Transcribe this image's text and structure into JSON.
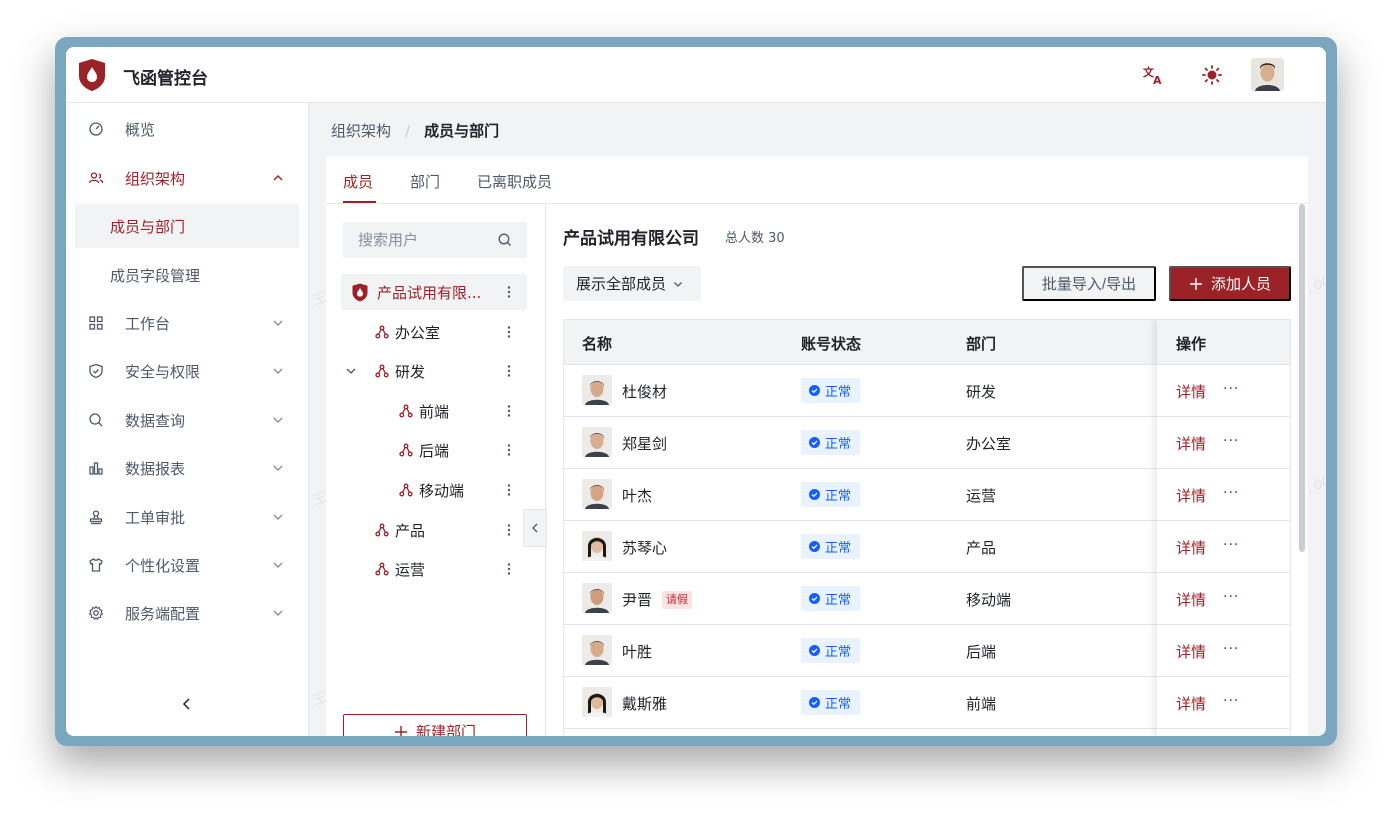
{
  "app": {
    "title": "飞函管控台"
  },
  "sidebar": {
    "items": [
      {
        "label": "概览"
      },
      {
        "label": "组织架构",
        "sub": [
          {
            "label": "成员与部门"
          },
          {
            "label": "成员字段管理"
          }
        ]
      },
      {
        "label": "工作台"
      },
      {
        "label": "安全与权限"
      },
      {
        "label": "数据查询"
      },
      {
        "label": "数据报表"
      },
      {
        "label": "工单审批"
      },
      {
        "label": "个性化设置"
      },
      {
        "label": "服务端配置"
      }
    ]
  },
  "breadcrumb": {
    "parent": "组织架构",
    "current": "成员与部门"
  },
  "tabs": [
    {
      "label": "成员"
    },
    {
      "label": "部门"
    },
    {
      "label": "已离职成员"
    }
  ],
  "tree": {
    "search_placeholder": "搜索用户",
    "nodes": [
      {
        "label": "产品试用有限..."
      },
      {
        "label": "办公室"
      },
      {
        "label": "研发"
      },
      {
        "label": "前端"
      },
      {
        "label": "后端"
      },
      {
        "label": "移动端"
      },
      {
        "label": "产品"
      },
      {
        "label": "运营"
      }
    ],
    "new_dept_label": "新建部门"
  },
  "panel": {
    "company": "产品试用有限公司",
    "total": "总人数 30",
    "filter_label": "展示全部成员",
    "import_label": "批量导入/导出",
    "add_label": "添加人员"
  },
  "table": {
    "headers": {
      "name": "名称",
      "status": "账号状态",
      "dept": "部门",
      "ops": "操作"
    },
    "rows": [
      {
        "name": "杜俊材",
        "status": "正常",
        "dept": "研发",
        "detail": "详情",
        "more": "···"
      },
      {
        "name": "郑星剑",
        "status": "正常",
        "dept": "办公室",
        "detail": "详情",
        "more": "···"
      },
      {
        "name": "叶杰",
        "status": "正常",
        "dept": "运营",
        "detail": "详情",
        "more": "···"
      },
      {
        "name": "苏琴心",
        "status": "正常",
        "dept": "产品",
        "detail": "详情",
        "more": "···"
      },
      {
        "name": "尹晋",
        "tag": "请假",
        "status": "正常",
        "dept": "移动端",
        "detail": "详情",
        "more": "···"
      },
      {
        "name": "叶胜",
        "status": "正常",
        "dept": "后端",
        "detail": "详情",
        "more": "···"
      },
      {
        "name": "戴斯雅",
        "status": "正常",
        "dept": "前端",
        "detail": "详情",
        "more": "···"
      }
    ]
  },
  "watermark": "王智跃 0000",
  "colors": {
    "brand": "#9b2226",
    "status_blue": "#165dff",
    "status_bg": "#e8f3ff"
  }
}
